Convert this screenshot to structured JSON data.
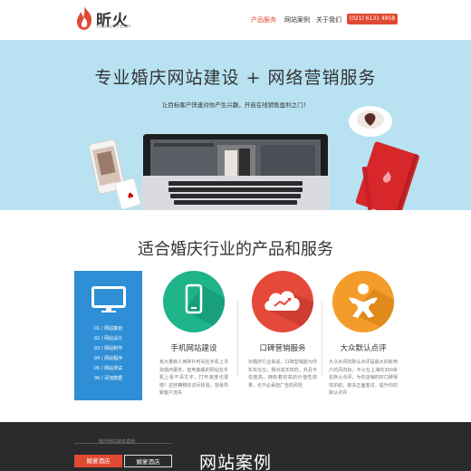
{
  "header": {
    "logo_text": "昕火",
    "logo_sub": "XINHUOTECH",
    "nav": [
      {
        "label": "产品服务",
        "active": true
      },
      {
        "label": "网站案例",
        "active": false
      },
      {
        "label": "关于我们",
        "active": false
      }
    ],
    "phone": "(021) 6131 4958"
  },
  "hero": {
    "title": "专业婚庆网站建设 + 网络营销服务",
    "subtitle": "让目标客户快速对你产生兴趣，开启在线销售盈利之门！"
  },
  "services": {
    "title": "适合婚庆行业的产品和服务",
    "menu": [
      "01 / 网站策划",
      "02 / 网站设计",
      "03 / 网站制作",
      "04 / 网站程序",
      "05 / 网站测试",
      "06 / 添加数据"
    ],
    "cards": [
      {
        "title": "手机网站建设",
        "icon": "mobile-icon",
        "color": "#1fb38a",
        "text": "有大量新人用碎片时间在手机上寻找婚庆服务，但电脑版的网站在手机上看不清文字，打开速度也很慢！这些糟糕的访问体验，容易导致客户流失"
      },
      {
        "title": "口碑营销服务",
        "icon": "cloud-chart-icon",
        "color": "#e5493a",
        "text": "对婚庆行业来说，口碑营销能为你实实在在，相对成本较低，并且可信度高，拥有着较高的价值性效果，也不必承担广告的风险"
      },
      {
        "title": "大众默认点评",
        "icon": "person-icon",
        "color": "#f39c2a",
        "text": "大众点评的默认点评是最大的新用户的风向标。平火在上海的300余名默认点评，为你店铺的好口碑保驾护航，被多正面客访，提升你的默认点评"
      }
    ]
  },
  "cases": {
    "small_text": "婚庆网站建设案例",
    "tabs": [
      "婚宴酒店",
      "婚宴酒店"
    ],
    "title": "网站案例"
  },
  "colors": {
    "accent": "#e04a32",
    "hero_bg": "#b8e2f1",
    "menu_blue": "#2f8fd6",
    "dark": "#2b2b2d"
  }
}
